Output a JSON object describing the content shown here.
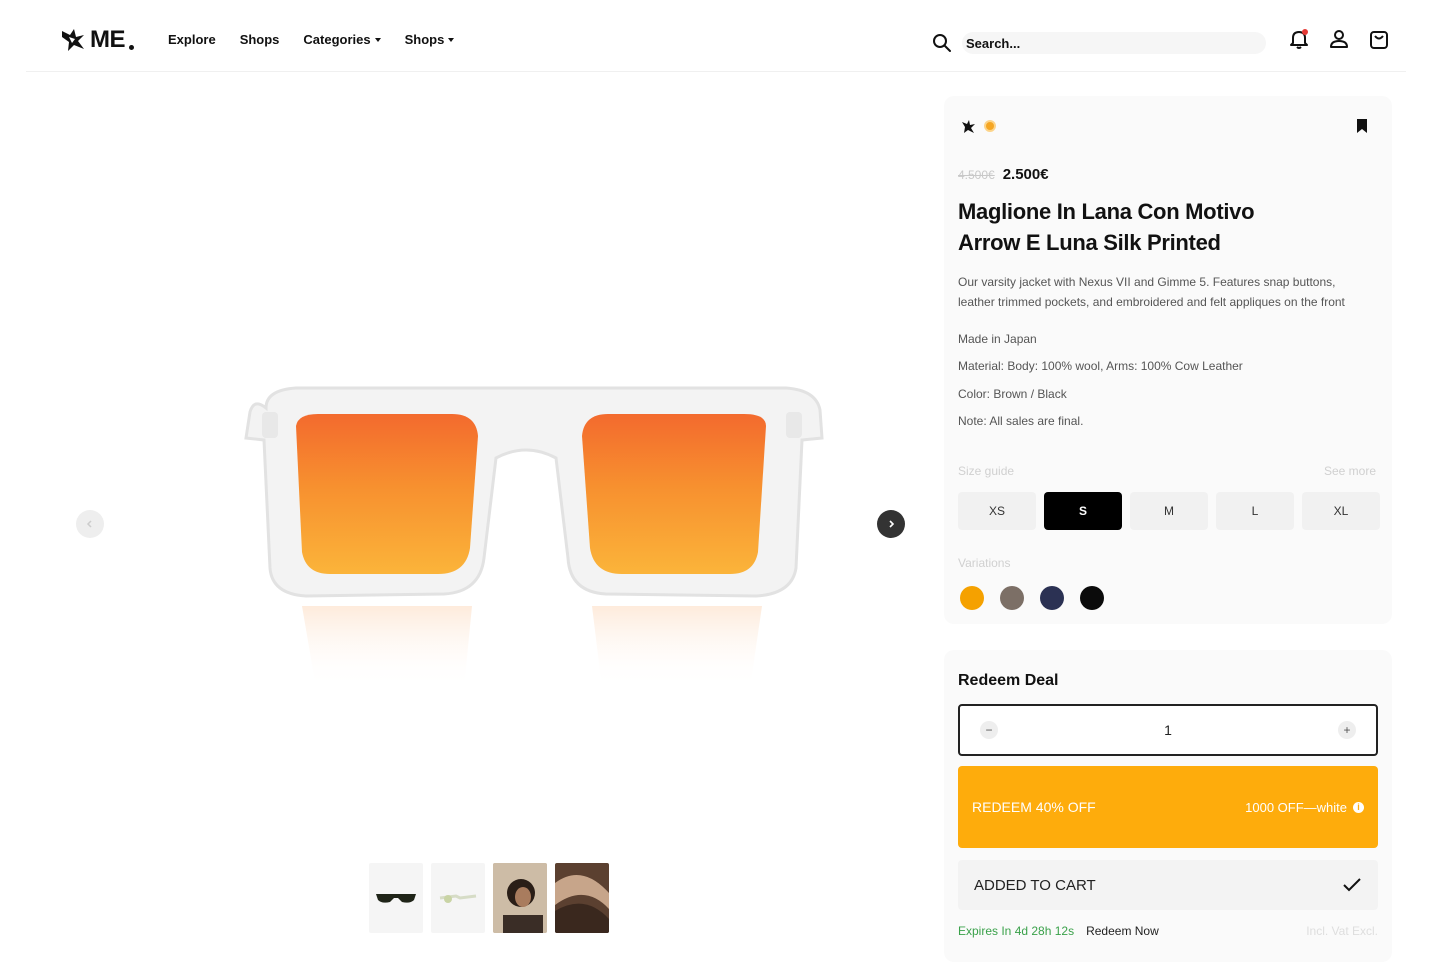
{
  "header": {
    "logo_text": "ME",
    "nav": [
      {
        "label": "Explore",
        "dropdown": false
      },
      {
        "label": "Shops",
        "dropdown": false
      },
      {
        "label": "Categories",
        "dropdown": true
      },
      {
        "label": "Shops",
        "dropdown": true
      }
    ],
    "search": {
      "placeholder": "Search..."
    },
    "icons": [
      "bell-icon",
      "user-icon",
      "bag-icon"
    ]
  },
  "gallery": {
    "thumbnails": [
      "dark-sunglasses",
      "clear-sunglasses-side",
      "portrait-person",
      "hair-closeup"
    ]
  },
  "product": {
    "old_price": "4.500€",
    "price": "2.500€",
    "title": "Maglione In Lana Con Motivo Arrow E Luna Silk Printed",
    "description": "Our varsity jacket with Nexus VII and Gimme 5. Features snap buttons, leather trimmed pockets, and embroidered and felt appliques on the front",
    "made_in": "Made in Japan",
    "material": "Material: Body: 100% wool, Arms: 100% Cow Leather",
    "color": "Color: Brown / Black",
    "note": "Note: All sales are final.",
    "size_guide_label": "Size guide",
    "see_more_label": "See more",
    "sizes": [
      "XS",
      "S",
      "M",
      "L",
      "XL"
    ],
    "selected_size": "S",
    "variations_label": "Variations",
    "variations": [
      "#f5a100",
      "#7c6f66",
      "#2b3153",
      "#0b0b0b"
    ]
  },
  "deal": {
    "title": "Redeem Deal",
    "quantity": "1",
    "minus": "−",
    "plus": "+",
    "redeem_label": "REDEEM 40% OFF",
    "redeem_right": "1000 OFF—white",
    "info": "i",
    "cart_label": "ADDED TO CART",
    "expires": "Expires In 4d 28h 12s",
    "redeem_now": "Redeem Now",
    "fine_print": "Incl. Vat Excl."
  },
  "colors": {
    "accent": "#ffa800",
    "success": "#3aa14a"
  }
}
